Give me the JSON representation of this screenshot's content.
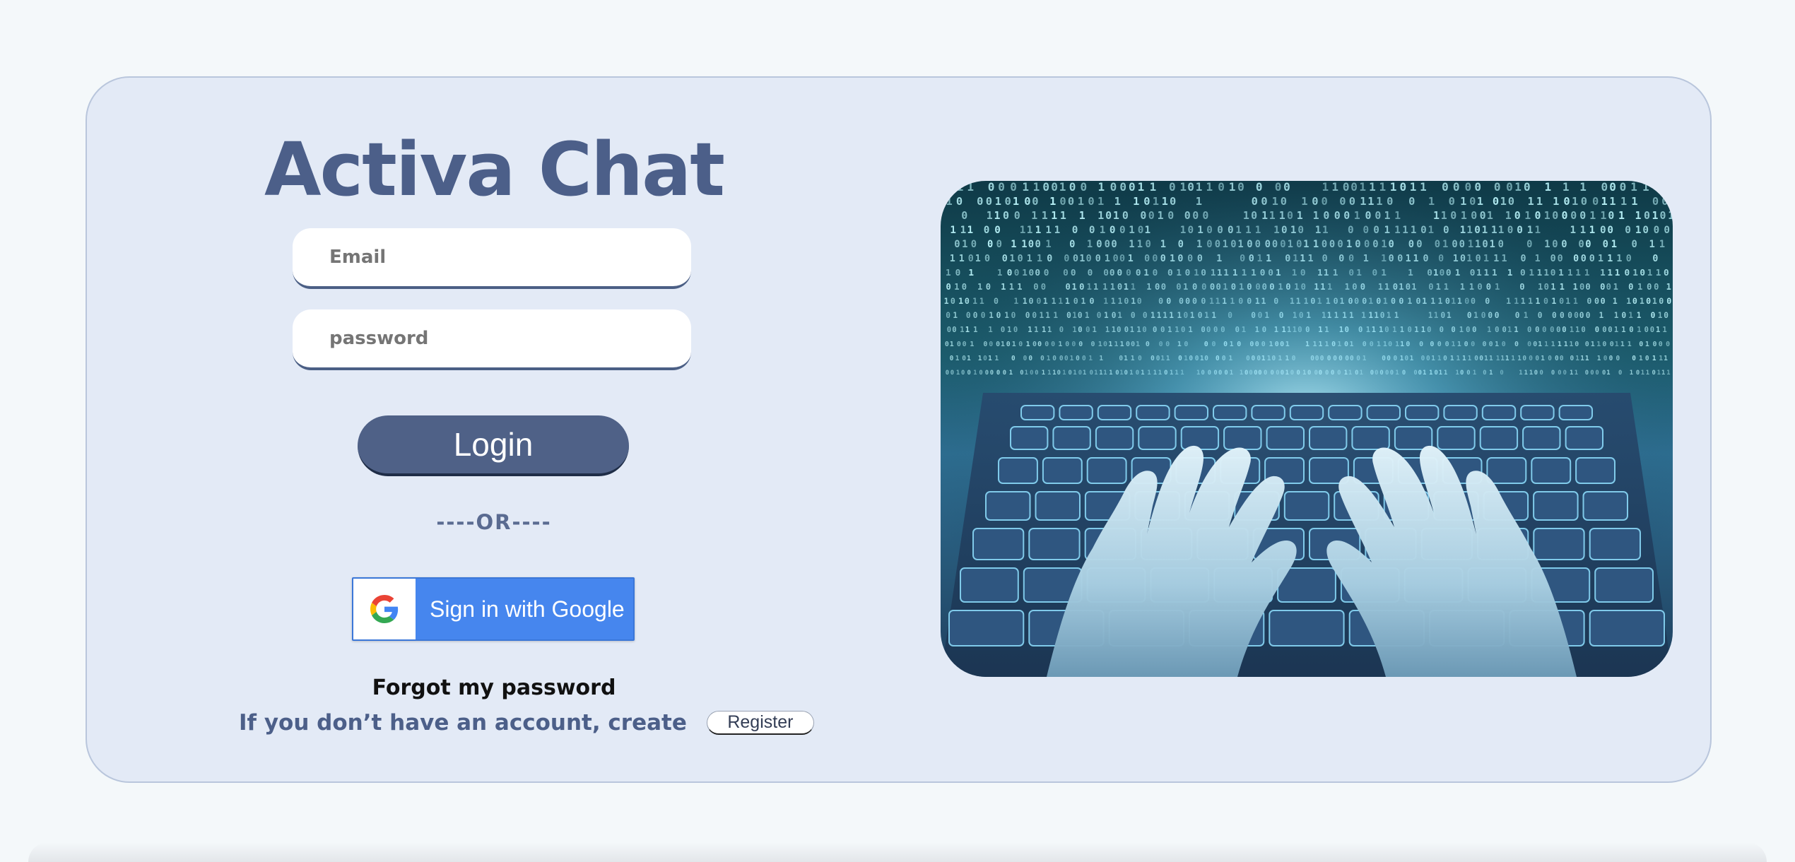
{
  "app": {
    "title": "Activa Chat"
  },
  "login_form": {
    "email_placeholder": "Email",
    "password_placeholder": "password",
    "login_label": "Login",
    "or_divider": "----OR----",
    "google_label": "Sign in with Google",
    "forgot_password": "Forgot my password",
    "register_prompt": "If you don’t have an account, create",
    "register_label": "Register"
  },
  "hero": {
    "image": "hands typing on glowing keyboard with binary code"
  },
  "colors": {
    "page_background": "#f4f8fa",
    "card_background": "#e3eaf6",
    "brand": "#4c5f89",
    "google_blue": "#4686ee"
  }
}
